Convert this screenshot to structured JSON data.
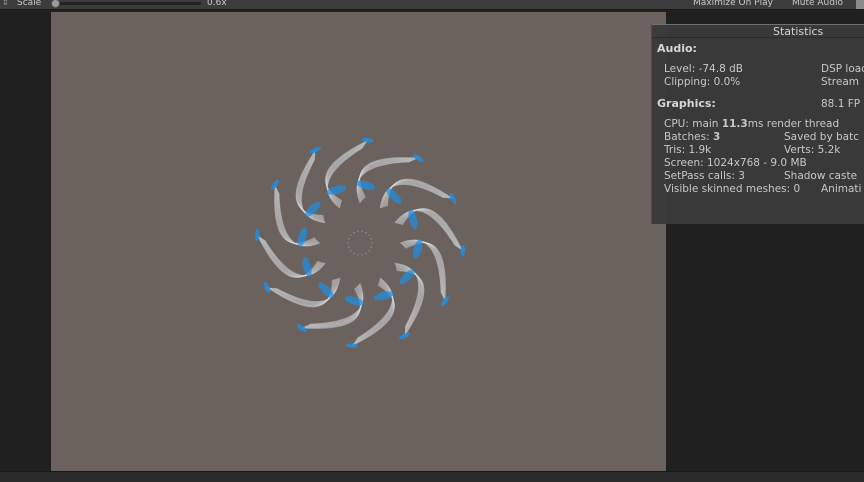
{
  "toolbar": {
    "arrows_icon": "updown-arrows-icon",
    "scale_label": "Scale",
    "scale_value": "0.6x",
    "scale_fraction": 0.0,
    "maximize_label": "Maximize On Play",
    "mute_label": "Mute Audio"
  },
  "stats": {
    "title": "Statistics",
    "audio_heading": "Audio:",
    "level": "Level: -74.8 dB",
    "clipping": "Clipping: 0.0%",
    "dsp_load": "DSP load",
    "stream": "Stream",
    "graphics_heading": "Graphics:",
    "fps": "88.1 FP",
    "cpu_prefix": "CPU: main ",
    "cpu_main": "11.3",
    "cpu_suffix": "ms  render thread",
    "batches_prefix": "Batches: ",
    "batches_value": "3",
    "saved_by_batching": "Saved by batc",
    "tris": "Tris: 1.9k",
    "verts": "Verts: 5.2k",
    "screen": "Screen: 1024x768 - 9.0 MB",
    "setpass": "SetPass calls: 3",
    "shadow_casters": "Shadow caste",
    "skinned": "Visible skinned meshes: 0",
    "animations": "Animati"
  },
  "colors": {
    "viewport_bg": "#6b615d",
    "particle_blue": "#1e8fe6",
    "particle_white": "#d8dde2"
  }
}
